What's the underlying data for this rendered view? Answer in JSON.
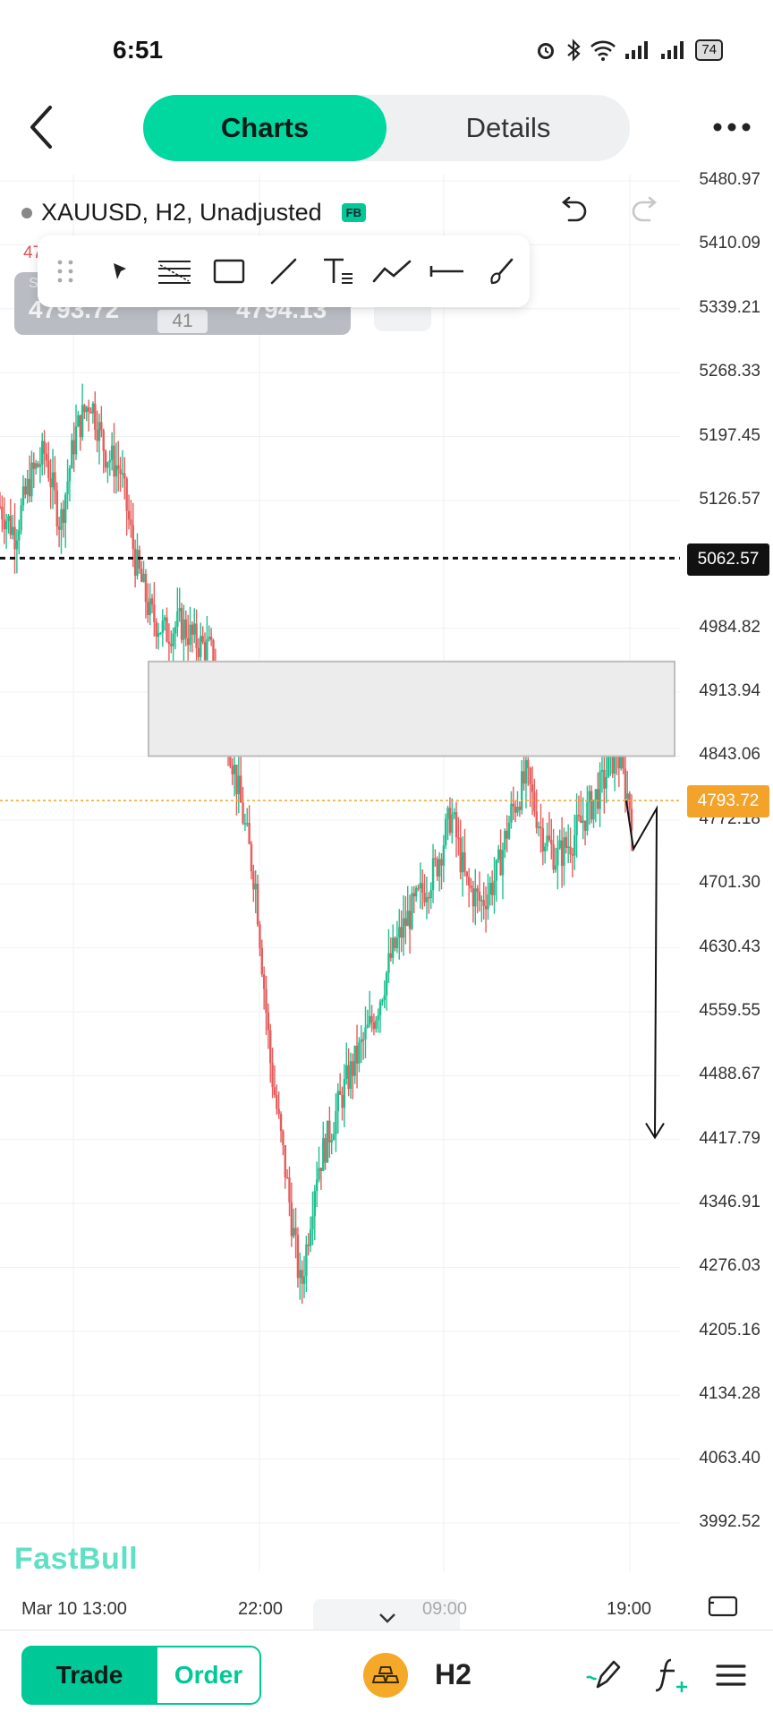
{
  "status_bar": {
    "time": "6:51",
    "battery": "74"
  },
  "header": {
    "tabs": [
      "Charts",
      "Details"
    ],
    "active_tab": "Charts"
  },
  "chart_header": {
    "symbol_line": "XAUUSD, H2, Unadjusted",
    "badge": "FB"
  },
  "spread": {
    "prefix": "S",
    "bid": "4793.72",
    "spread": "41",
    "ask": "4794.13",
    "red_tag": "47"
  },
  "price_axis": [
    "5480.97",
    "5410.09",
    "5339.21",
    "5268.33",
    "5197.45",
    "5126.57",
    "4984.82",
    "4913.94",
    "4843.06",
    "4772.18",
    "4701.30",
    "4630.43",
    "4559.55",
    "4488.67",
    "4417.79",
    "4346.91",
    "4276.03",
    "4205.16",
    "4134.28",
    "4063.40",
    "3992.52"
  ],
  "reference_price": "5062.57",
  "current_price": "4793.72",
  "time_axis": [
    "Mar 10 13:00",
    "22:00",
    "09:00",
    "19:00"
  ],
  "watermark": "FastBull",
  "bottom_bar": {
    "trade_label": "Trade",
    "order_label": "Order",
    "timeframe": "H2"
  },
  "colors": {
    "accent": "#00d8a0",
    "up": "#1fbf8f",
    "down": "#e65c5c",
    "current_price": "#f3a32a",
    "reference": "#111111"
  },
  "icons": [
    "back-arrow-icon",
    "more-icon",
    "undo-icon",
    "redo-icon",
    "drag-handle-icon",
    "cursor-icon",
    "fib-icon",
    "rectangle-icon",
    "line-icon",
    "text-icon",
    "polyline-icon",
    "horizontal-line-icon",
    "brush-icon",
    "gold-bars-icon",
    "pen-icon",
    "indicator-icon",
    "menu-icon",
    "fullscreen-icon",
    "chevron-down-icon"
  ],
  "chart_data": {
    "type": "candlestick",
    "symbol": "XAUUSD",
    "timeframe": "H2",
    "ylim": [
      3992.52,
      5480.97
    ],
    "x_ticks": [
      "Mar 10 13:00",
      "22:00",
      "09:00",
      "19:00"
    ],
    "reference_line": 5062.57,
    "current_line": 4793.72,
    "zone": [
      4843.06,
      4913.94
    ],
    "path_close": [
      5120,
      5090,
      5150,
      5180,
      5100,
      5200,
      5240,
      5180,
      5160,
      5060,
      5000,
      4980,
      4990,
      4970,
      4960,
      4880,
      4790,
      4700,
      4500,
      4380,
      4250,
      4380,
      4430,
      4480,
      4520,
      4560,
      4620,
      4660,
      4690,
      4720,
      4780,
      4700,
      4680,
      4710,
      4780,
      4820,
      4760,
      4730,
      4750,
      4780,
      4810,
      4850,
      4780
    ],
    "projection": [
      [
        4793.72,
        4740
      ],
      [
        4740,
        4785
      ],
      [
        4785,
        4420
      ]
    ]
  }
}
